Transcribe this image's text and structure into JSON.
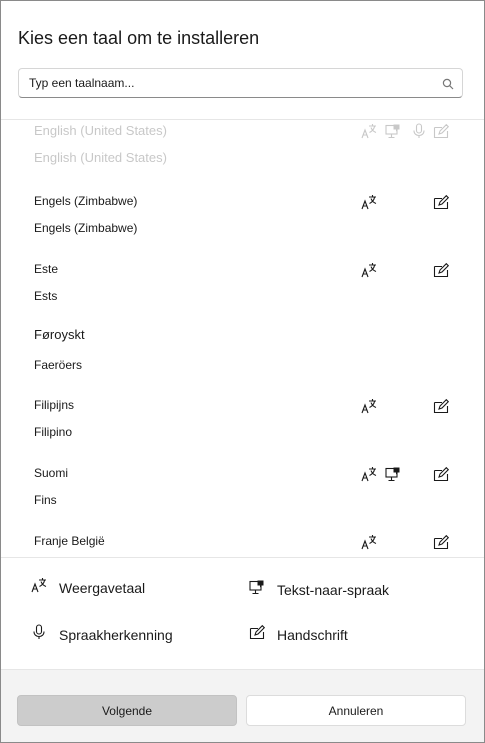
{
  "dialog": {
    "title": "Kies een taal om te installeren"
  },
  "search": {
    "placeholder": "Typ een taalnaam...",
    "value": ""
  },
  "languages": [
    {
      "native": "English (United States)",
      "translated": "English (United States)",
      "features": [
        "display",
        "tts",
        "speech",
        "handwriting"
      ],
      "faded": true
    },
    {
      "native": "Engels (Zimbabwe)",
      "translated": "Engels (Zimbabwe)",
      "features": [
        "display",
        "handwriting"
      ]
    },
    {
      "native": "Este",
      "translated": "Ests",
      "features": [
        "display",
        "handwriting"
      ]
    },
    {
      "native": "Føroyskt",
      "translated": "Faeröers",
      "features": []
    },
    {
      "native": "Filipijns",
      "translated": "Filipino",
      "features": [
        "display",
        "handwriting"
      ]
    },
    {
      "native": "Suomi",
      "translated": "Fins",
      "features": [
        "display",
        "tts",
        "handwriting"
      ]
    },
    {
      "native": "Franje België",
      "translated": "",
      "features": [
        "display",
        "handwriting"
      ]
    }
  ],
  "legend": {
    "display": "Weergavetaal",
    "tts": "Tekst-naar-spraak",
    "speech": "Spraakherkenning",
    "handwriting": "Handschrift"
  },
  "buttons": {
    "next": "Volgende",
    "cancel": "Annuleren"
  },
  "icons": {
    "search": "search-icon",
    "display": "display-language-icon",
    "tts": "text-to-speech-icon",
    "speech": "microphone-icon",
    "handwriting": "handwriting-icon"
  },
  "colors": {
    "primary_button": "#cccccc",
    "footer_bg": "#f3f3f3",
    "faded_text": "#c8c8c8"
  }
}
